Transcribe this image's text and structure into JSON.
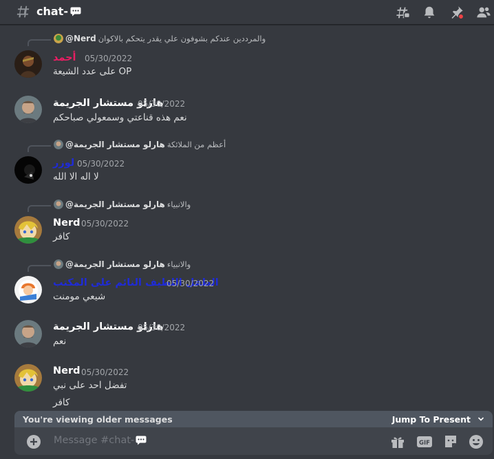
{
  "header": {
    "channel_name": "chat-",
    "icons": [
      "hash-icon",
      "threads-icon",
      "bell-icon",
      "pin-icon",
      "members-icon"
    ]
  },
  "messages": [
    {
      "reply": {
        "user": "@Nerd",
        "text": "والمرددين عندكم بشوفون علي يقدر يتحكم بالاكوان"
      },
      "username": "أحمد",
      "username_color": "#e91e63",
      "timestamp": "05/30/2022",
      "lines": [
        "على عدد الشيعة OP"
      ]
    },
    {
      "username": "هارلو مستشار الجريمة",
      "username_color": "#ffffff",
      "timestamp": "05/30/2022",
      "lines": [
        "نعم هذه قناعتي وسمعولي صباحكم"
      ]
    },
    {
      "reply": {
        "user": "@هارلو مستشار الجريمة",
        "text": "أعظم من الملائكة"
      },
      "username": "لوزر",
      "username_color": "#1f2bd6",
      "timestamp": "05/30/2022",
      "lines": [
        "لا اله الا الله"
      ]
    },
    {
      "reply": {
        "user": "@هارلو مستشار الجريمة",
        "text": "والانبياء"
      },
      "username": "Nerd",
      "username_color": "#ffffff",
      "timestamp": "05/30/2022",
      "lines": [
        "كافر"
      ]
    },
    {
      "reply": {
        "user": "@هارلو مستشار الجريمة",
        "text": "والانبياء"
      },
      "username": "الطفل اللطيف النائم على المكتب",
      "username_color": "#1f2bd6",
      "timestamp": "05/30/2022",
      "lines": [
        "شيعي مومنت"
      ]
    },
    {
      "username": "هارلو مستشار الجريمة",
      "username_color": "#ffffff",
      "timestamp": "05/30/2022",
      "lines": [
        "نعم"
      ]
    },
    {
      "username": "Nerd",
      "username_color": "#ffffff",
      "timestamp": "05/30/2022",
      "lines": [
        "تفضل احد على نبي",
        "كافر"
      ]
    }
  ],
  "composer": {
    "older_notice": "You're viewing older messages",
    "jump_label": "Jump To Present",
    "placeholder": "Message #chat-"
  }
}
